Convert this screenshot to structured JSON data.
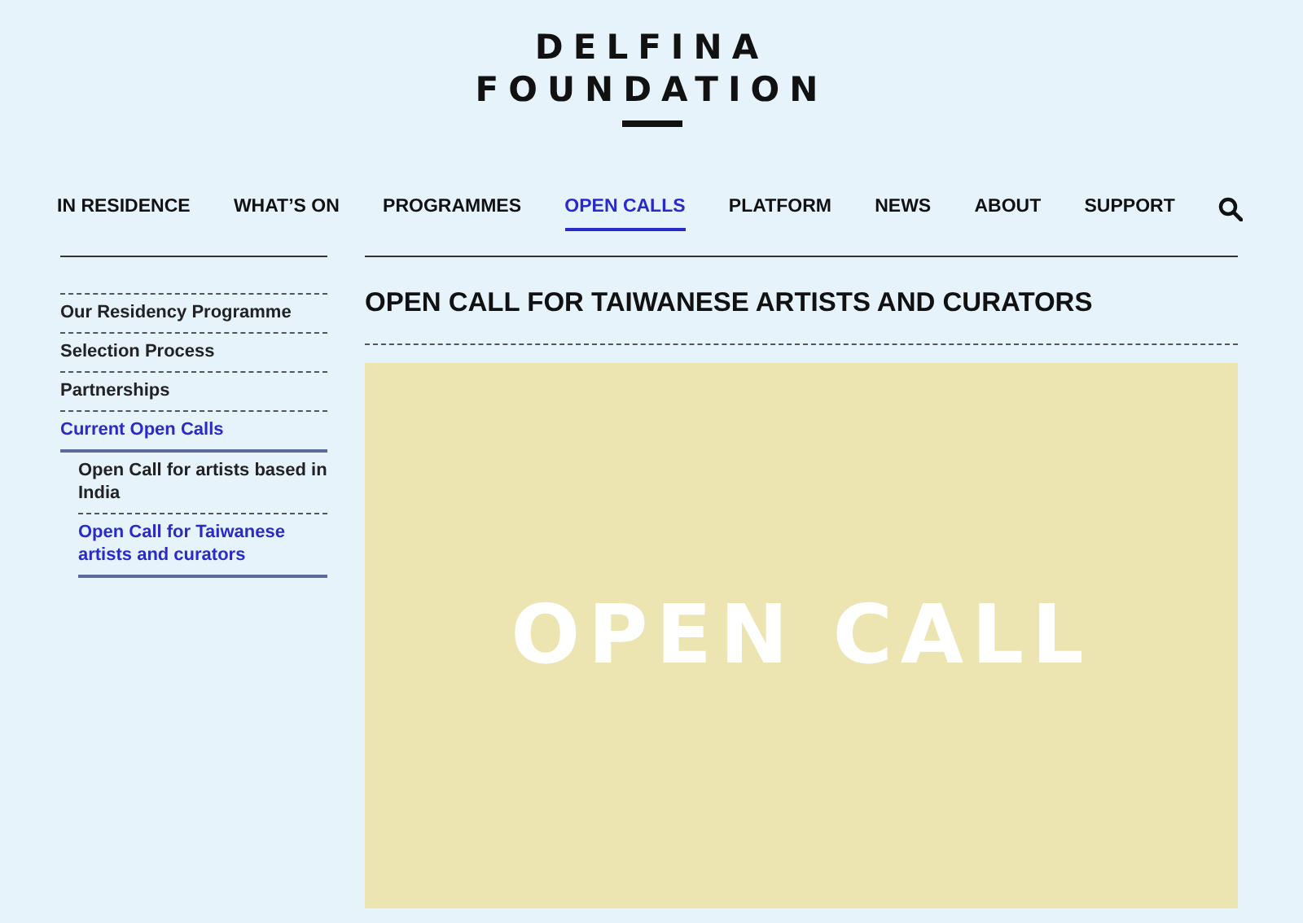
{
  "logo": {
    "line_1": "DELFINA",
    "line_2": "FOUNDATION"
  },
  "nav": [
    {
      "label": "IN RESIDENCE",
      "selected": false
    },
    {
      "label": "WHAT’S ON",
      "selected": false
    },
    {
      "label": "PROGRAMMES",
      "selected": false
    },
    {
      "label": "OPEN CALLS",
      "selected": true
    },
    {
      "label": "PLATFORM",
      "selected": false
    },
    {
      "label": "NEWS",
      "selected": false
    },
    {
      "label": "ABOUT",
      "selected": false
    },
    {
      "label": "SUPPORT",
      "selected": false
    }
  ],
  "sidebar": {
    "items": [
      {
        "label": "Our Residency Programme",
        "selected": false
      },
      {
        "label": "Selection Process",
        "selected": false
      },
      {
        "label": "Partnerships",
        "selected": false
      },
      {
        "label": "Current Open Calls",
        "selected": true,
        "children": [
          {
            "label": "Open Call for artists based in India",
            "selected": false
          },
          {
            "label": "Open Call for Taiwanese artists and curators",
            "selected": true
          }
        ]
      }
    ]
  },
  "page": {
    "title": "OPEN CALL FOR TAIWANESE ARTISTS AND CURATORS",
    "banner": {
      "text": "OPEN CALL"
    }
  }
}
